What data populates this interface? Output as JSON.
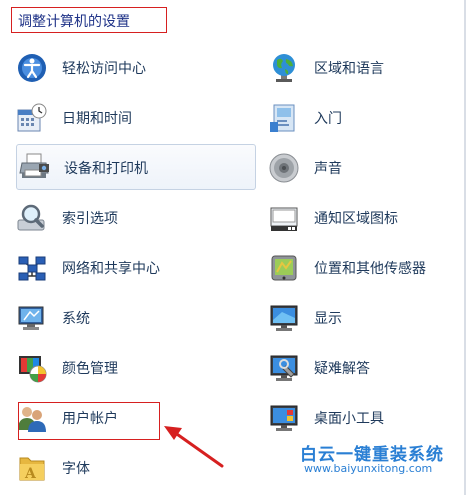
{
  "header": {
    "title": "调整计算机的设置"
  },
  "items": [
    {
      "label": "轻松访问中心",
      "icon": "ease-of-access-icon"
    },
    {
      "label": "区域和语言",
      "icon": "globe-icon"
    },
    {
      "label": "日期和时间",
      "icon": "calendar-clock-icon"
    },
    {
      "label": "入门",
      "icon": "getting-started-icon"
    },
    {
      "label": "设备和打印机",
      "icon": "printer-icon"
    },
    {
      "label": "声音",
      "icon": "speaker-icon"
    },
    {
      "label": "索引选项",
      "icon": "magnifier-icon"
    },
    {
      "label": "通知区域图标",
      "icon": "notification-area-icon"
    },
    {
      "label": "网络和共享中心",
      "icon": "network-icon"
    },
    {
      "label": "位置和其他传感器",
      "icon": "location-sensor-icon"
    },
    {
      "label": "系统",
      "icon": "system-icon"
    },
    {
      "label": "显示",
      "icon": "display-icon"
    },
    {
      "label": "颜色管理",
      "icon": "color-management-icon"
    },
    {
      "label": "疑难解答",
      "icon": "troubleshooting-icon"
    },
    {
      "label": "用户帐户",
      "icon": "user-accounts-icon"
    },
    {
      "label": "桌面小工具",
      "icon": "desktop-gadgets-icon"
    },
    {
      "label": "字体",
      "icon": "fonts-folder-icon"
    }
  ],
  "watermark": {
    "title": "白云一键重装系统",
    "url": "www.baiyunxitong.com"
  },
  "colors": {
    "highlight": "#d62020",
    "link_text": "#1e395b",
    "watermark": "#2a7fd4"
  }
}
